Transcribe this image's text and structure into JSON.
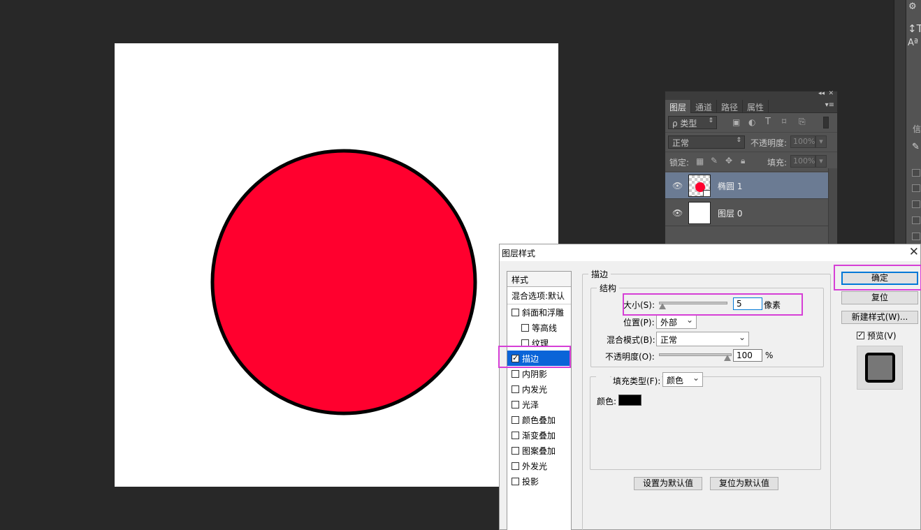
{
  "canvas": {
    "fill_color": "#ff002e",
    "stroke_color": "#000000"
  },
  "layers_panel": {
    "tabs": [
      "图层",
      "通道",
      "路径",
      "属性"
    ],
    "filter_label": "ρ 类型",
    "blend_mode": "正常",
    "opacity_label": "不透明度:",
    "opacity_value": "100%",
    "lock_label": "锁定:",
    "fill_label": "填充:",
    "fill_value": "100%",
    "layers": [
      {
        "name": "椭圆 1",
        "selected": true
      },
      {
        "name": "图层 0",
        "selected": false
      }
    ]
  },
  "dialog": {
    "title": "图层样式",
    "styles_header": "样式",
    "blend_options": "混合选项:默认",
    "styles": [
      {
        "label": "斜面和浮雕",
        "checked": false,
        "sub": false
      },
      {
        "label": "等高线",
        "checked": false,
        "sub": true
      },
      {
        "label": "纹理",
        "checked": false,
        "sub": true
      },
      {
        "label": "描边",
        "checked": true,
        "sub": false,
        "active": true
      },
      {
        "label": "内阴影",
        "checked": false,
        "sub": false
      },
      {
        "label": "内发光",
        "checked": false,
        "sub": false
      },
      {
        "label": "光泽",
        "checked": false,
        "sub": false
      },
      {
        "label": "颜色叠加",
        "checked": false,
        "sub": false
      },
      {
        "label": "渐变叠加",
        "checked": false,
        "sub": false
      },
      {
        "label": "图案叠加",
        "checked": false,
        "sub": false
      },
      {
        "label": "外发光",
        "checked": false,
        "sub": false
      },
      {
        "label": "投影",
        "checked": false,
        "sub": false
      }
    ],
    "stroke_group": "描边",
    "structure_group": "结构",
    "size_label": "大小(S):",
    "size_value": "5",
    "size_unit": "像素",
    "position_label": "位置(P):",
    "position_value": "外部",
    "blend_label": "混合模式(B):",
    "blend_value": "正常",
    "opacity_label": "不透明度(O):",
    "opacity_value": "100",
    "opacity_unit": "%",
    "fill_type_label": "填充类型(F):",
    "fill_type_value": "颜色",
    "color_label": "颜色:",
    "stroke_color": "#000000",
    "set_default": "设置为默认值",
    "reset_default": "复位为默认值",
    "ok": "确定",
    "reset": "复位",
    "new_style": "新建样式(W)...",
    "preview_label": "预览(V)",
    "preview_checked": true
  },
  "right_strip": {
    "glyphs": [
      "⚙",
      "↕T",
      "Aª",
      "信"
    ]
  }
}
